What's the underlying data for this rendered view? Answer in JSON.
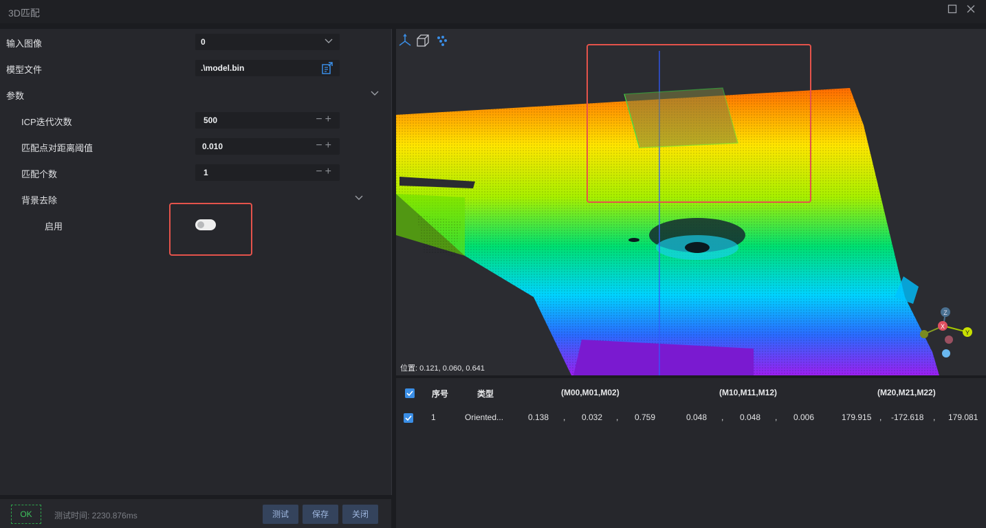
{
  "window": {
    "title": "3D匹配"
  },
  "left": {
    "input_image_label": "输入图像",
    "input_image_value": "0",
    "model_file_label": "模型文件",
    "model_file_value": ".\\model.bin",
    "params_label": "参数",
    "icp_label": "ICP迭代次数",
    "icp_value": "500",
    "dist_label": "匹配点对距离阈值",
    "dist_value": "0.010",
    "count_label": "匹配个数",
    "count_value": "1",
    "bg_label": "背景去除",
    "enable_label": "启用",
    "enable_on": false
  },
  "bottom": {
    "status": "OK",
    "test_time": "测试时间: 2230.876ms",
    "test_btn": "测试",
    "save_btn": "保存",
    "close_btn": "关闭"
  },
  "viewport": {
    "position_text": "位置: 0.121, 0.060, 0.641"
  },
  "table": {
    "headers": {
      "index": "序号",
      "type": "类型",
      "m0": "(M00,M01,M02)",
      "m1": "(M10,M11,M12)",
      "m2": "(M20,M21,M22)"
    },
    "row": {
      "index": "1",
      "type": "Oriented...",
      "m00": "0.138",
      "m01": "0.032",
      "m02": "0.759",
      "m10": "0.048",
      "m11": "0.048",
      "m12": "0.006",
      "m20": "179.915",
      "m21": "-172.618",
      "m22": "179.081",
      "sep": ","
    }
  },
  "colors": {
    "accent": "#3a8ee6",
    "highlight": "#e5534b",
    "ok_green": "#3ec45d"
  }
}
